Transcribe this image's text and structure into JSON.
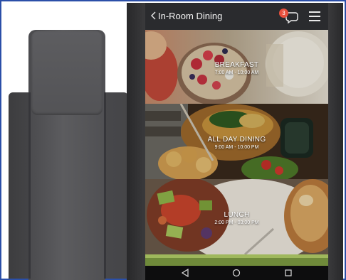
{
  "header": {
    "title": "In-Room Dining",
    "chat_badge_count": "3",
    "back_icon": "chevron-left-icon",
    "chat_icon": "chat-bubble-icon",
    "menu_icon": "hamburger-menu-icon"
  },
  "tiles": [
    {
      "title": "BREAKFAST",
      "hours": "7:00 AM - 10:00 AM"
    },
    {
      "title": "ALL DAY DINING",
      "hours": "9:00 AM - 10:00 PM"
    },
    {
      "title": "LUNCH",
      "hours": "2:00 PM - 03:00 PM"
    }
  ],
  "nav": {
    "back_icon": "nav-back-triangle-icon",
    "home_icon": "nav-home-circle-icon",
    "recents_icon": "nav-recents-square-icon"
  },
  "colors": {
    "frame_border": "#2b4fa8",
    "badge": "#e8503d",
    "header_bg": "#2a2b2e"
  }
}
